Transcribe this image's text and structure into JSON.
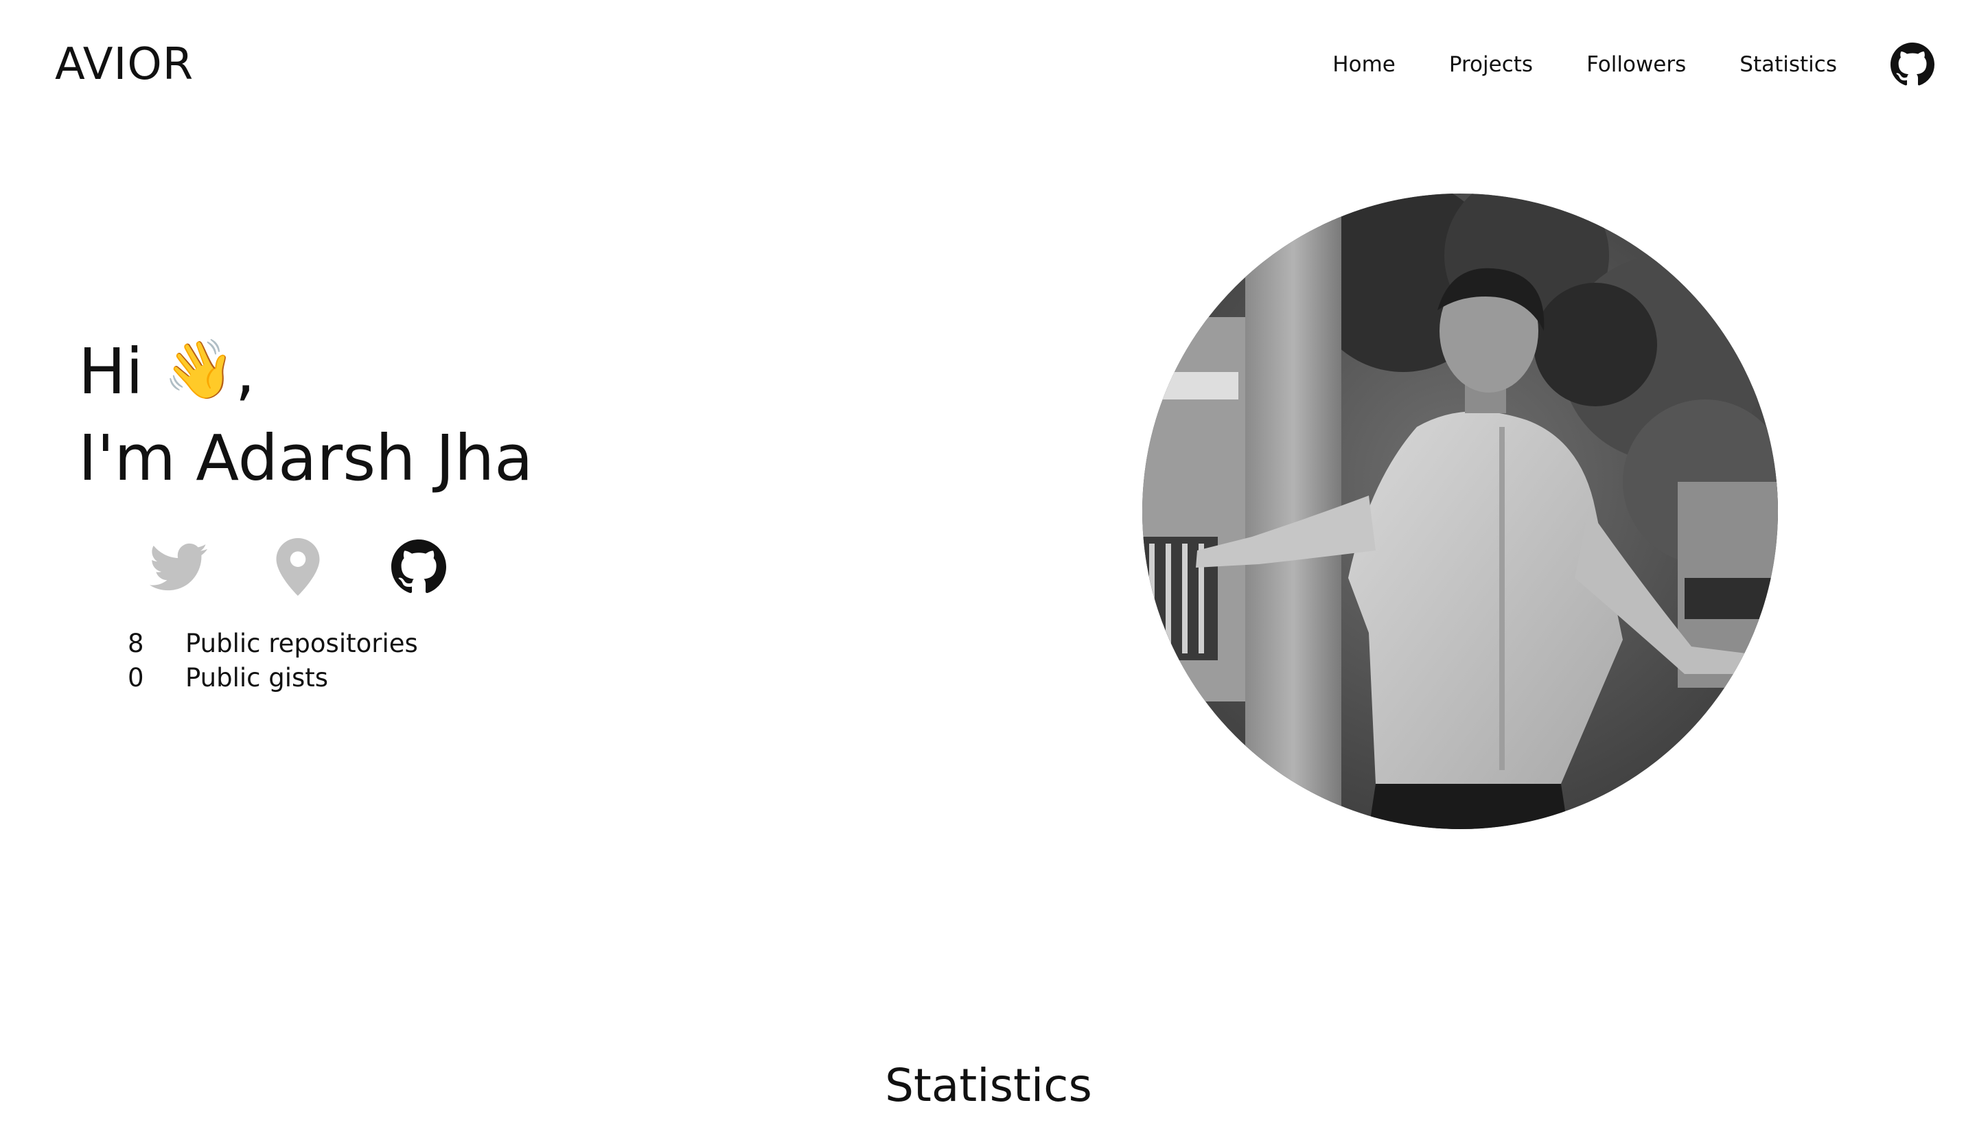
{
  "brand": "AVIOR",
  "nav": {
    "home": "Home",
    "projects": "Projects",
    "followers": "Followers",
    "statistics": "Statistics"
  },
  "hero": {
    "greeting": "Hi",
    "wave": "👋",
    "comma": ",",
    "intro": "I'm Adarsh Jha"
  },
  "stats": {
    "repos_count": "8",
    "repos_label": "Public repositories",
    "gists_count": "0",
    "gists_label": "Public gists"
  },
  "section": {
    "title": "Statistics"
  },
  "icons": {
    "twitter": "twitter-icon",
    "location": "location-pin-icon",
    "github": "github-icon"
  },
  "colors": {
    "muted_icon": "#c2c2c2",
    "text": "#111111"
  }
}
